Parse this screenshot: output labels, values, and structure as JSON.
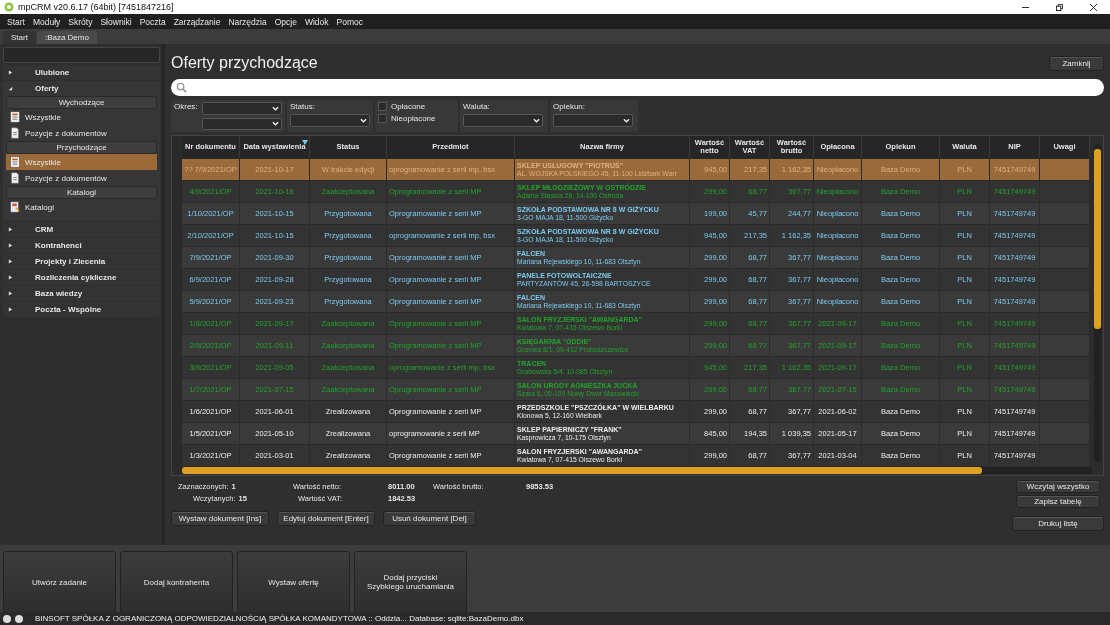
{
  "window": {
    "title": "mpCRM v20.6.17 (64bit) [7451847216]"
  },
  "menu": [
    "Start",
    "Moduły",
    "Skróty",
    "Słowniki",
    "Poczta",
    "Zarządzanie",
    "Narzędzia",
    "Opcje",
    "Widok",
    "Pomoc"
  ],
  "tabs": [
    {
      "label": "Start",
      "selected": false
    },
    {
      "label": ":Baza Demo",
      "selected": true
    }
  ],
  "sidebar": {
    "sections": [
      {
        "label": "Ulubione",
        "expanded": false
      },
      {
        "label": "Oferty",
        "expanded": true,
        "groups": [
          {
            "label": "Wychodzące",
            "items": [
              {
                "label": "Wszystkie",
                "kind": "list",
                "selected": false
              },
              {
                "label": "Pozycje z dokumentów",
                "kind": "doc",
                "selected": false
              }
            ]
          },
          {
            "label": "Przychodzące",
            "items": [
              {
                "label": "Wszystkie",
                "kind": "list",
                "selected": true
              },
              {
                "label": "Pozycje z dokumentów",
                "kind": "doc",
                "selected": false
              }
            ]
          },
          {
            "label": "Katalogi",
            "items": [
              {
                "label": "Katalogi",
                "kind": "catalog",
                "selected": false
              }
            ]
          }
        ]
      },
      {
        "label": "CRM",
        "expanded": false
      },
      {
        "label": "Kontrahenci",
        "expanded": false
      },
      {
        "label": "Projekty i Zlecenia",
        "expanded": false
      },
      {
        "label": "Rozliczenia cykliczne",
        "expanded": false
      },
      {
        "label": "Baza wiedzy",
        "expanded": false
      },
      {
        "label": "Poczta - Wspólne",
        "expanded": false
      }
    ]
  },
  "page": {
    "title": "Oferty przychodzące",
    "close_button": "Zamknij"
  },
  "filters": {
    "period_label": "Okres:",
    "status_label": "Status:",
    "checkboxes": [
      {
        "label": "Opłacone",
        "checked": false
      },
      {
        "label": "Nieopłacone",
        "checked": false
      }
    ],
    "currency_label": "Waluta:",
    "owner_label": "Opiekun:"
  },
  "table": {
    "columns": [
      {
        "label": "Nr dokumentu",
        "sorted": false
      },
      {
        "label": "Data wystawienia",
        "sorted": true
      },
      {
        "label": "Status",
        "sorted": false
      },
      {
        "label": "Przedmiot",
        "sorted": false
      },
      {
        "label": "Nazwa firmy",
        "sorted": false
      },
      {
        "label": "Wartość netto",
        "sorted": false
      },
      {
        "label": "Wartość VAT",
        "sorted": false
      },
      {
        "label": "Wartość brutto",
        "sorted": false
      },
      {
        "label": "Opłacona",
        "sorted": false
      },
      {
        "label": "Opiekun",
        "sorted": false
      },
      {
        "label": "Waluta",
        "sorted": false
      },
      {
        "label": "NIP",
        "sorted": false
      },
      {
        "label": "Uwagi",
        "sorted": false
      }
    ],
    "rows": [
      {
        "kind": "editing",
        "selected": true,
        "nr": "?? 7/9/2021/OP",
        "date": "2021-10-17",
        "status": "W trakcie edycji",
        "subject": "oprogramowanie z serii mp, bsx",
        "firm": "SKLEP USŁUGOWY \"PIOTRUŚ\"",
        "address": "AL. WOJSKA POLSKIEGO 45, 11-100 Lidzbark Warr",
        "net": "945,00",
        "vat": "217,35",
        "gross": "1 162,35",
        "paid": "Nieopłacono",
        "owner": "Baza Demo",
        "currency": "PLN",
        "nip": "7451749749"
      },
      {
        "kind": "accepted",
        "selected": false,
        "nr": "4/9/2021/OP",
        "date": "2021-10-18",
        "status": "Zaakceptowana",
        "subject": "Oprogramowanie z serii MP",
        "firm": "SKLEP MŁODZIEŻOWY W OSTRÓDZIE",
        "address": "Adama Stasica 26, 14-100 Ostróda",
        "net": "299,00",
        "vat": "68,77",
        "gross": "367,77",
        "paid": "Nieopłacono",
        "owner": "Baza Demo",
        "currency": "PLN",
        "nip": "7451749749"
      },
      {
        "kind": "prepared",
        "selected": false,
        "nr": "1/10/2021/OP",
        "date": "2021-10-15",
        "status": "Przygotowana",
        "subject": "Oprogramowanie z serii MP",
        "firm": "SZKOŁA PODSTAWOWA NR 8 W GIŻYCKU",
        "address": "3-GO MAJA 18, 11-500 Giżycko",
        "net": "199,00",
        "vat": "45,77",
        "gross": "244,77",
        "paid": "Nieopłacono",
        "owner": "Baza Demo",
        "currency": "PLN",
        "nip": "7451749749"
      },
      {
        "kind": "prepared",
        "selected": false,
        "nr": "2/10/2021/OP",
        "date": "2021-10-15",
        "status": "Przygotowana",
        "subject": "oprogramowanie z serii mp, bsx",
        "firm": "SZKOŁA PODSTAWOWA NR 8 W GIŻYCKU",
        "address": "3-GO MAJA 18, 11-500 Giżycko",
        "net": "945,00",
        "vat": "217,35",
        "gross": "1 162,35",
        "paid": "Nieopłacono",
        "owner": "Baza Demo",
        "currency": "PLN",
        "nip": "7451749749"
      },
      {
        "kind": "prepared",
        "selected": false,
        "nr": "7/9/2021/OP",
        "date": "2021-09-30",
        "status": "Przygotowana",
        "subject": "Oprogramowanie z serii MP",
        "firm": "FALCEN",
        "address": "Mariana Rejewskiego 10, 11-683 Olsztyn",
        "net": "299,00",
        "vat": "68,77",
        "gross": "367,77",
        "paid": "Nieopłacono",
        "owner": "Baza Demo",
        "currency": "PLN",
        "nip": "7451749749"
      },
      {
        "kind": "prepared",
        "selected": false,
        "nr": "6/9/2021/OP",
        "date": "2021-09-28",
        "status": "Przygotowana",
        "subject": "Oprogramowanie z serii MP",
        "firm": "PANELE FOTOWOLTAICZNE",
        "address": "PARTYZANTÓW 45, 26-598 BARTOSZYCE",
        "net": "299,00",
        "vat": "68,77",
        "gross": "367,77",
        "paid": "Nieopłacono",
        "owner": "Baza Demo",
        "currency": "PLN",
        "nip": "7451749749"
      },
      {
        "kind": "prepared",
        "selected": false,
        "nr": "5/9/2021/OP",
        "date": "2021-09-23",
        "status": "Przygotowana",
        "subject": "Oprogramowanie z serii MP",
        "firm": "FALCEN",
        "address": "Mariana Rejewskiego 10, 11-683 Olsztyn",
        "net": "299,00",
        "vat": "68,77",
        "gross": "367,77",
        "paid": "Nieopłacono",
        "owner": "Baza Demo",
        "currency": "PLN",
        "nip": "7451749749"
      },
      {
        "kind": "accepted",
        "selected": false,
        "nr": "1/8/2021/OP",
        "date": "2021-09-17",
        "status": "Zaakceptowana",
        "subject": "Oprogramowanie z serii MP",
        "firm": "SALON FRYZJERSKI \"AWANGARDA\"",
        "address": "Kwiatowa 7, 07-415 Olszewo Borki",
        "net": "299,00",
        "vat": "68,77",
        "gross": "367,77",
        "paid": "2021-09-17",
        "owner": "Baza Demo",
        "currency": "PLN",
        "nip": "7451749749"
      },
      {
        "kind": "accepted",
        "selected": false,
        "nr": "2/9/2021/OP",
        "date": "2021-09-11",
        "status": "Zaakceptowana",
        "subject": "Oprogramowanie z serii MP",
        "firm": "KSIĘGARNIA \"ODDIE\"",
        "address": "Gromka 8/1, 09-412 Proboszczewice",
        "net": "299,00",
        "vat": "68,77",
        "gross": "367,77",
        "paid": "2021-09-17",
        "owner": "Baza Demo",
        "currency": "PLN",
        "nip": "7451749749"
      },
      {
        "kind": "accepted",
        "selected": false,
        "nr": "3/9/2021/OP",
        "date": "2021-09-05",
        "status": "Zaakceptowana",
        "subject": "oprogramowanie z serii mp, bsx",
        "firm": "TRACEN",
        "address": "Grabowska 5/4, 10-085 Olsztyn",
        "net": "945,00",
        "vat": "217,35",
        "gross": "1 162,35",
        "paid": "2021-09-17",
        "owner": "Baza Demo",
        "currency": "PLN",
        "nip": "7451749749"
      },
      {
        "kind": "accepted",
        "selected": false,
        "nr": "1/7/2021/OP",
        "date": "2021-07-15",
        "status": "Zaakceptowana",
        "subject": "Oprogramowanie z serii MP",
        "firm": "SALON URODY AGNIESZKA JUCKA",
        "address": "Szara 6, 05-100 Nowy Dwór Mazowiecki",
        "net": "299,00",
        "vat": "68,77",
        "gross": "367,77",
        "paid": "2021-07-15",
        "owner": "Baza Demo",
        "currency": "PLN",
        "nip": "7451749749"
      },
      {
        "kind": "done",
        "selected": false,
        "nr": "1/6/2021/OP",
        "date": "2021-06-01",
        "status": "Zrealizowana",
        "subject": "Oprogramowanie z serii MP",
        "firm": "PRZEDSZKOLE \"PSZCZÓŁKA\" W WIELBARKU",
        "address": "Klonowa 5, 12-160 Wielbark",
        "net": "299,00",
        "vat": "68,77",
        "gross": "367,77",
        "paid": "2021-06-02",
        "owner": "Baza Demo",
        "currency": "PLN",
        "nip": "7451749749"
      },
      {
        "kind": "done",
        "selected": false,
        "nr": "1/5/2021/OP",
        "date": "2021-05-10",
        "status": "Zrealizowana",
        "subject": "oprogramowanie z serii MP",
        "firm": "SKLEP PAPIERNICZY \"FRANK\"",
        "address": "Kasprowicza 7, 10-175 Olsztyn",
        "net": "845,00",
        "vat": "194,35",
        "gross": "1 039,35",
        "paid": "2021-05-17",
        "owner": "Baza Demo",
        "currency": "PLN",
        "nip": "7451749749"
      },
      {
        "kind": "done",
        "selected": false,
        "nr": "1/3/2021/OP",
        "date": "2021-03-01",
        "status": "Zrealizowana",
        "subject": "Oprogramowanie z serii MP",
        "firm": "SALON FRYZJERSKI \"AWANGARDA\"",
        "address": "Kwiatowa 7, 07-415 Olszewo Borki",
        "net": "299,00",
        "vat": "68,77",
        "gross": "367,77",
        "paid": "2021-03-04",
        "owner": "Baza Demo",
        "currency": "PLN",
        "nip": "7451749749"
      }
    ]
  },
  "summary": [
    {
      "label": "Zaznaczonych:",
      "value": "1"
    },
    {
      "label": "Wartość netto:",
      "value": "8011.00"
    },
    {
      "label": "Wartość brutto:",
      "value": "9853.53"
    },
    {
      "label": "Wczytanych:",
      "value": "15"
    },
    {
      "label": "Wartość VAT:",
      "value": "1842.53"
    }
  ],
  "actions": [
    "Wystaw dokument [Ins]",
    "Edytuj dokument [Enter]",
    "Usuń dokument [Del]"
  ],
  "side_buttons": [
    "Wczytaj wszystko",
    "Zapisz tabelę"
  ],
  "print_button": "Drukuj listę",
  "quick_buttons": [
    "Utwórz zadanie",
    "Dodaj kontrahenta",
    "Wystaw ofertę",
    "Dodaj przyciski\nSzybkiego uruchamiania"
  ],
  "status_bar": "BINSOFT SPÓŁKA Z OGRANICZONĄ ODPOWIEDZIALNOŚCIĄ SPÓŁKA KOMANDYTOWA :: Oddzia... Database: sqlite:BazaDemo.dbx"
}
